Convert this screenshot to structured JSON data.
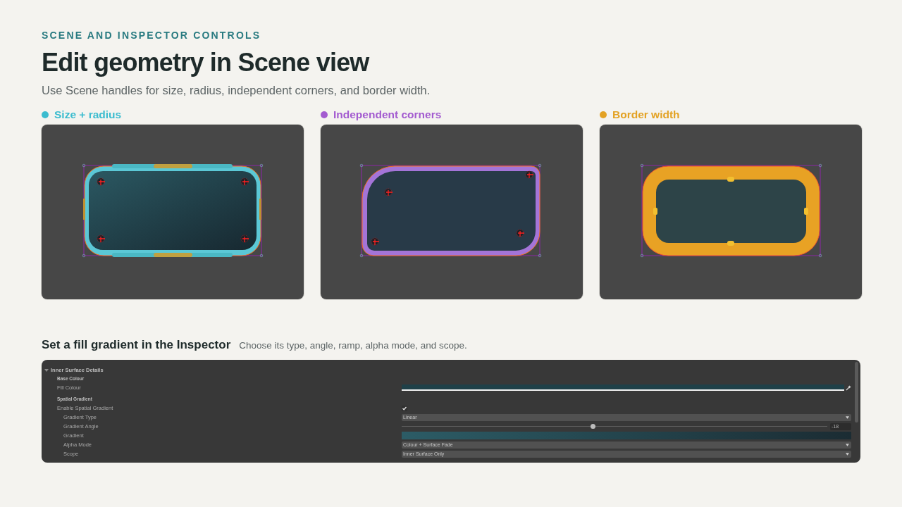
{
  "eyebrow": "SCENE AND INSPECTOR CONTROLS",
  "title": "Edit geometry in Scene view",
  "subtitle": "Use Scene handles for size, radius, independent corners, and border width.",
  "panels": [
    {
      "label": "Size + radius",
      "color": "#3bbccf",
      "kind": "size_radius"
    },
    {
      "label": "Independent corners",
      "color": "#a35bd0",
      "kind": "corners"
    },
    {
      "label": "Border width",
      "color": "#e3a224",
      "kind": "border"
    }
  ],
  "inspector_section": {
    "title": "Set a fill gradient in the Inspector",
    "note": "Choose its type, angle, ramp, alpha mode, and scope."
  },
  "inspector": {
    "rows": [
      {
        "kind": "foldout",
        "label": "Inner Surface Details",
        "expanded": true,
        "children": [
          {
            "kind": "header",
            "label": "Base Colour"
          },
          {
            "kind": "color",
            "label": "Fill Colour"
          },
          {
            "kind": "header",
            "label": "Spatial Gradient"
          },
          {
            "kind": "checkbox",
            "label": "Enable Spatial Gradient",
            "checked": true,
            "children": [
              {
                "kind": "dropdown",
                "label": "Gradient Type",
                "value": "Linear"
              },
              {
                "kind": "slider",
                "label": "Gradient Angle",
                "level": 0.45,
                "value": "-18"
              },
              {
                "kind": "gradient",
                "label": "Gradient"
              },
              {
                "kind": "dropdown",
                "label": "Alpha Mode",
                "value": "Colour + Surface Fade"
              },
              {
                "kind": "dropdown",
                "label": "Scope",
                "value": "Inner Surface Only"
              }
            ]
          }
        ]
      }
    ]
  }
}
